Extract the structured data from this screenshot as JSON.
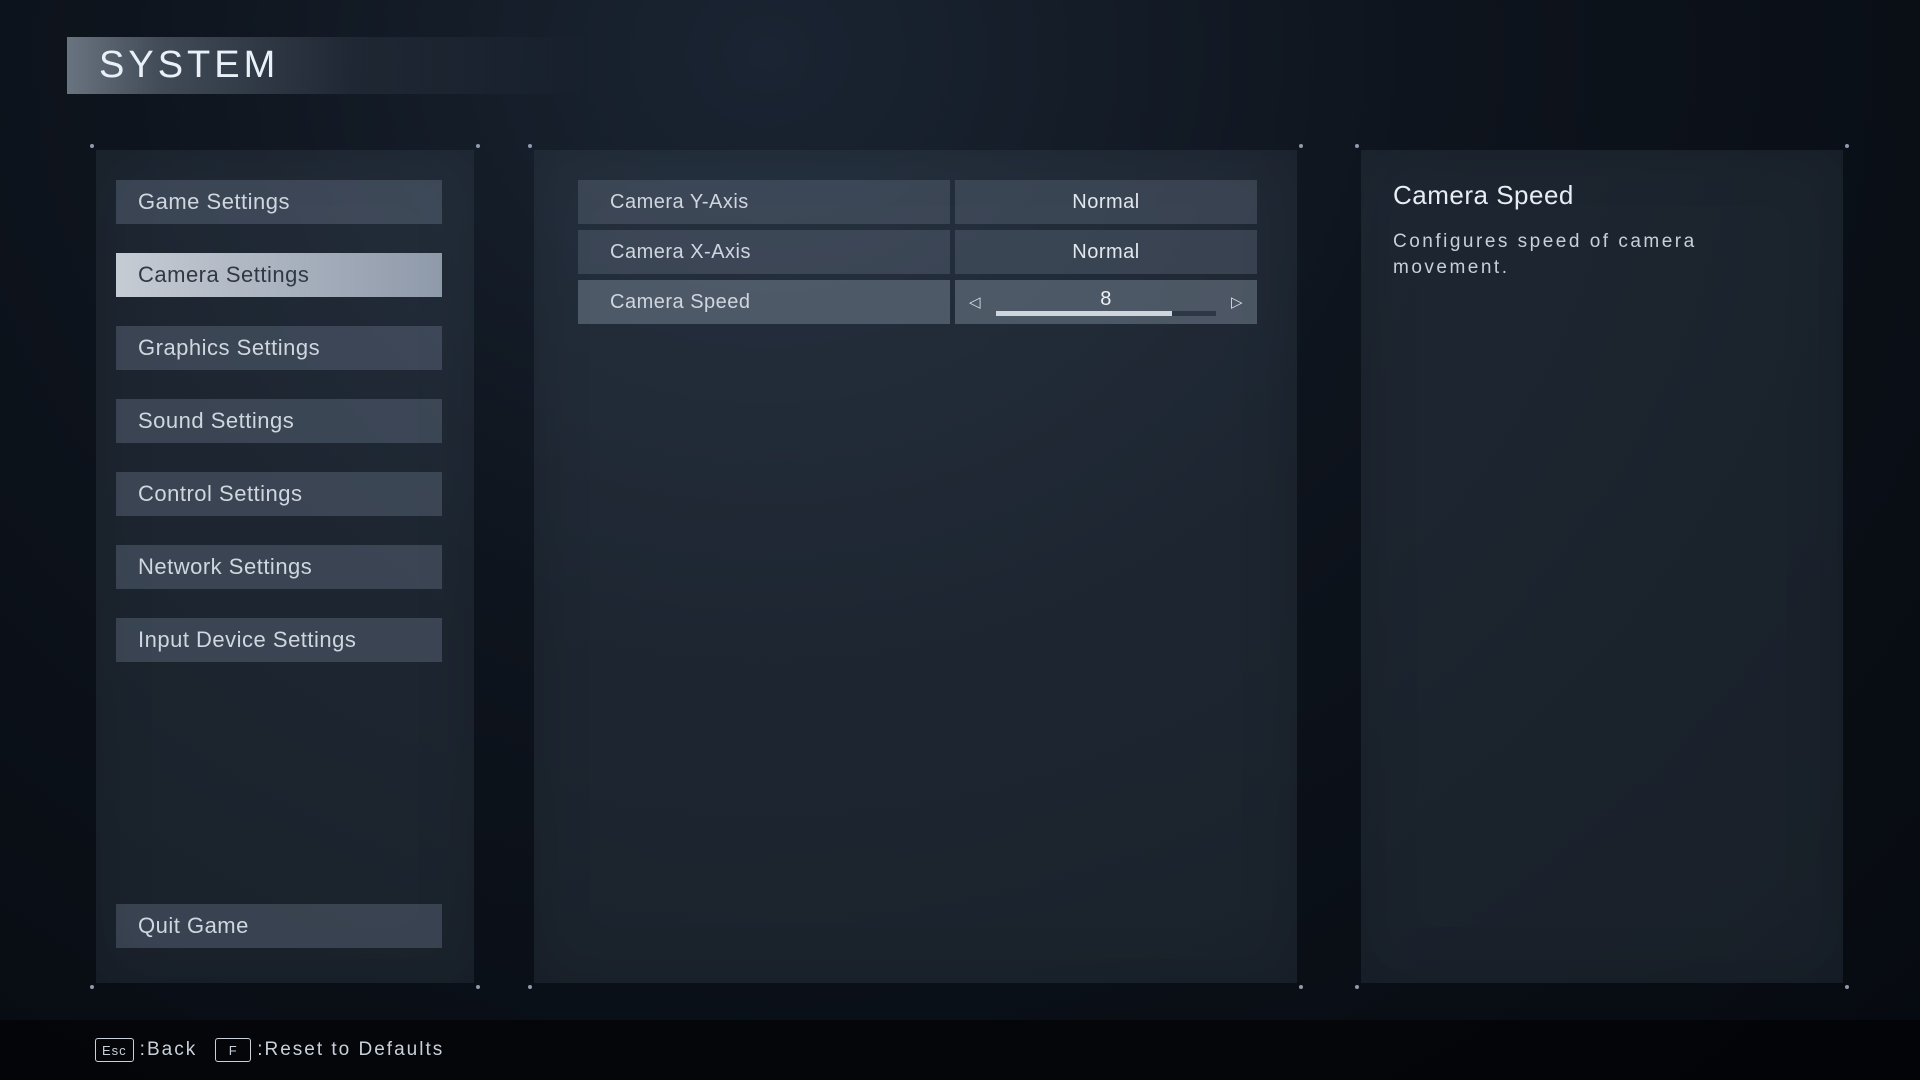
{
  "header": {
    "title": "SYSTEM"
  },
  "sidebar": {
    "selected_index": 1,
    "items": [
      {
        "label": "Game Settings"
      },
      {
        "label": "Camera Settings"
      },
      {
        "label": "Graphics Settings"
      },
      {
        "label": "Sound Settings"
      },
      {
        "label": "Control Settings"
      },
      {
        "label": "Network Settings"
      },
      {
        "label": "Input Device Settings"
      }
    ],
    "quit_label": "Quit Game"
  },
  "main": {
    "highlight_index": 2,
    "rows": [
      {
        "label": "Camera Y-Axis",
        "type": "choice",
        "value": "Normal"
      },
      {
        "label": "Camera X-Axis",
        "type": "choice",
        "value": "Normal"
      },
      {
        "label": "Camera Speed",
        "type": "slider",
        "value": 8,
        "min": 0,
        "max": 10
      }
    ]
  },
  "desc": {
    "title": "Camera Speed",
    "body": "Configures speed of camera movement."
  },
  "footer": {
    "items": [
      {
        "key": "Esc",
        "label": "Back"
      },
      {
        "key": "F",
        "label": "Reset to Defaults"
      }
    ]
  }
}
